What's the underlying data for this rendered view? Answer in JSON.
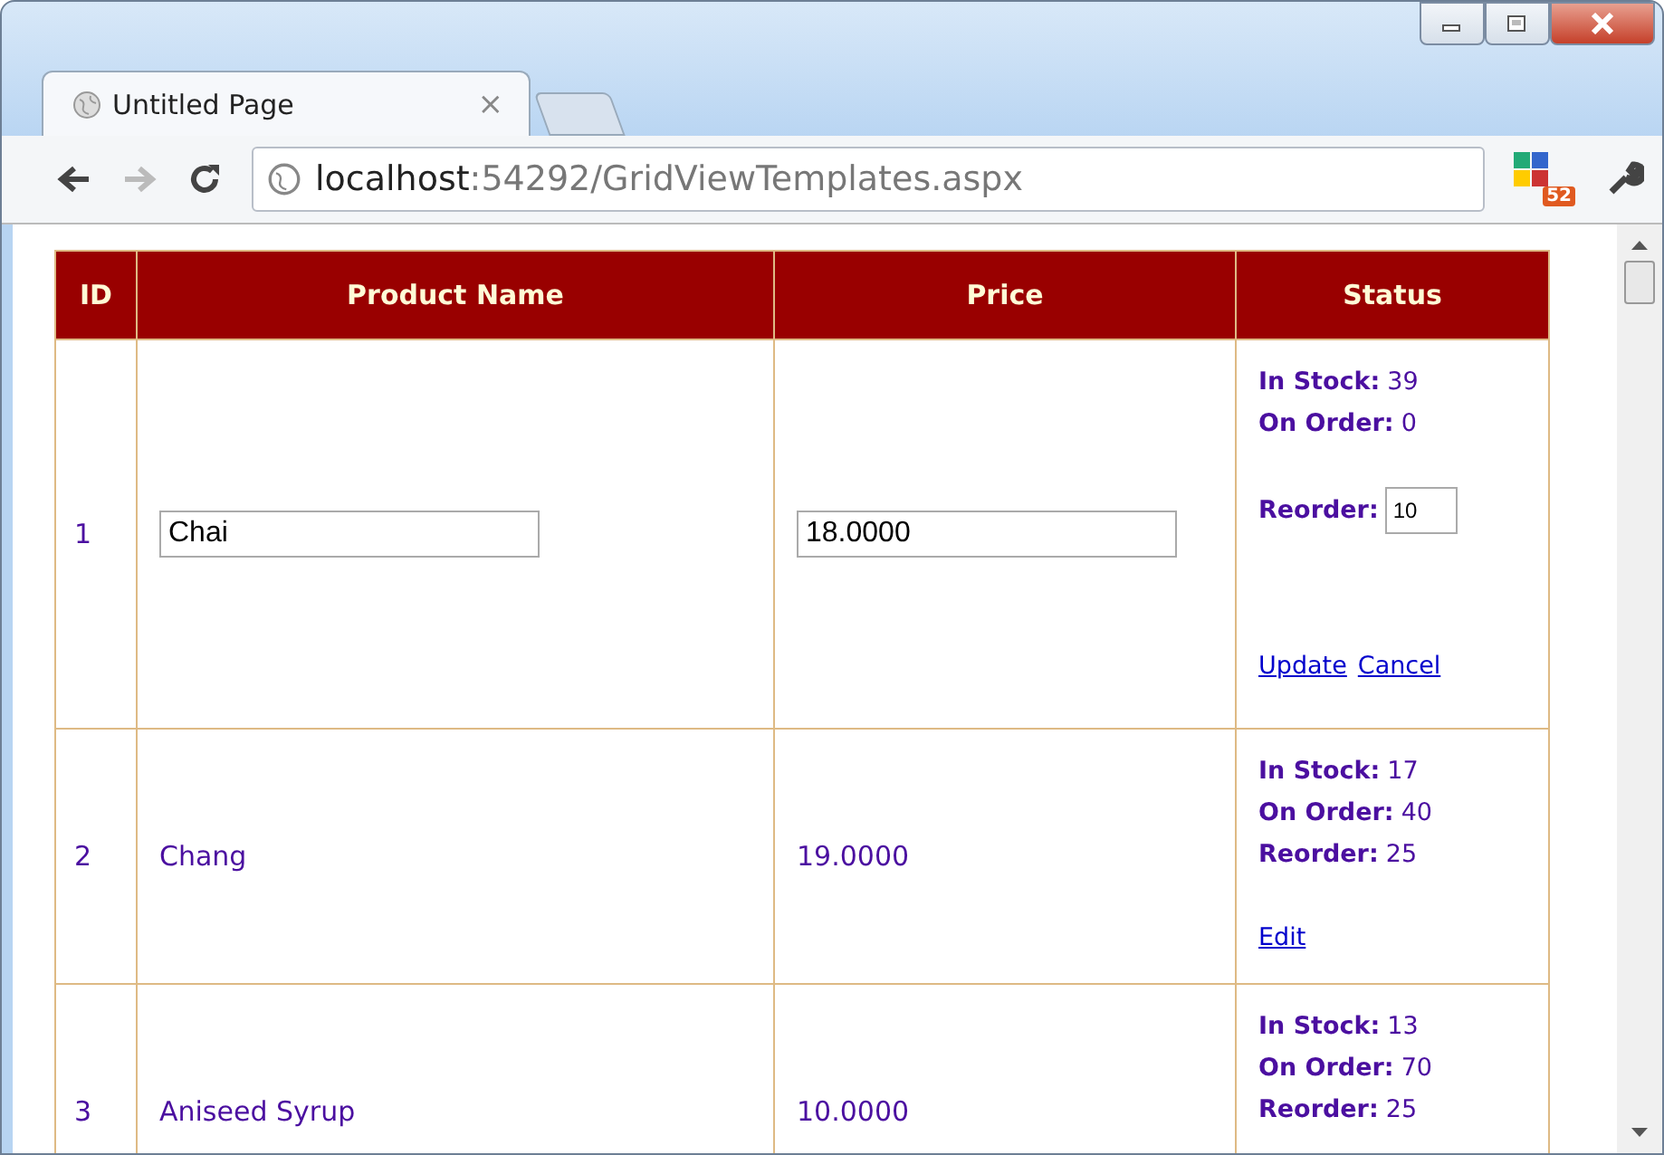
{
  "tab": {
    "title": "Untitled Page",
    "close": "×",
    "selected": true
  },
  "address": {
    "host": "localhost",
    "path": ":54292/GridViewTemplates.aspx"
  },
  "extension_badge": "52",
  "table": {
    "columns": [
      "ID",
      "Product Name",
      "Price",
      "Status"
    ],
    "rows": [
      {
        "kind": "edit",
        "id": "1",
        "name": "Chai",
        "price": "18.0000",
        "status": [
          {
            "label": "In Stock:",
            "value": "39",
            "kind": "text"
          },
          {
            "label": "On Order:",
            "value": "0",
            "kind": "text"
          },
          {
            "label": "Reorder:",
            "value": "10",
            "kind": "input"
          }
        ],
        "links": [
          "Update",
          "Cancel"
        ]
      },
      {
        "kind": "view",
        "id": "2",
        "name": "Chang",
        "price": "19.0000",
        "status": [
          {
            "label": "In Stock:",
            "value": "17",
            "kind": "text"
          },
          {
            "label": "On Order:",
            "value": "40",
            "kind": "text"
          },
          {
            "label": "Reorder:",
            "value": "25",
            "kind": "text"
          }
        ],
        "links": [
          "Edit"
        ]
      },
      {
        "kind": "view",
        "id": "3",
        "name": "Aniseed Syrup",
        "price": "10.0000",
        "status": [
          {
            "label": "In Stock:",
            "value": "13",
            "kind": "text"
          },
          {
            "label": "On Order:",
            "value": "70",
            "kind": "text"
          },
          {
            "label": "Reorder:",
            "value": "25",
            "kind": "text"
          }
        ],
        "links": []
      }
    ]
  }
}
